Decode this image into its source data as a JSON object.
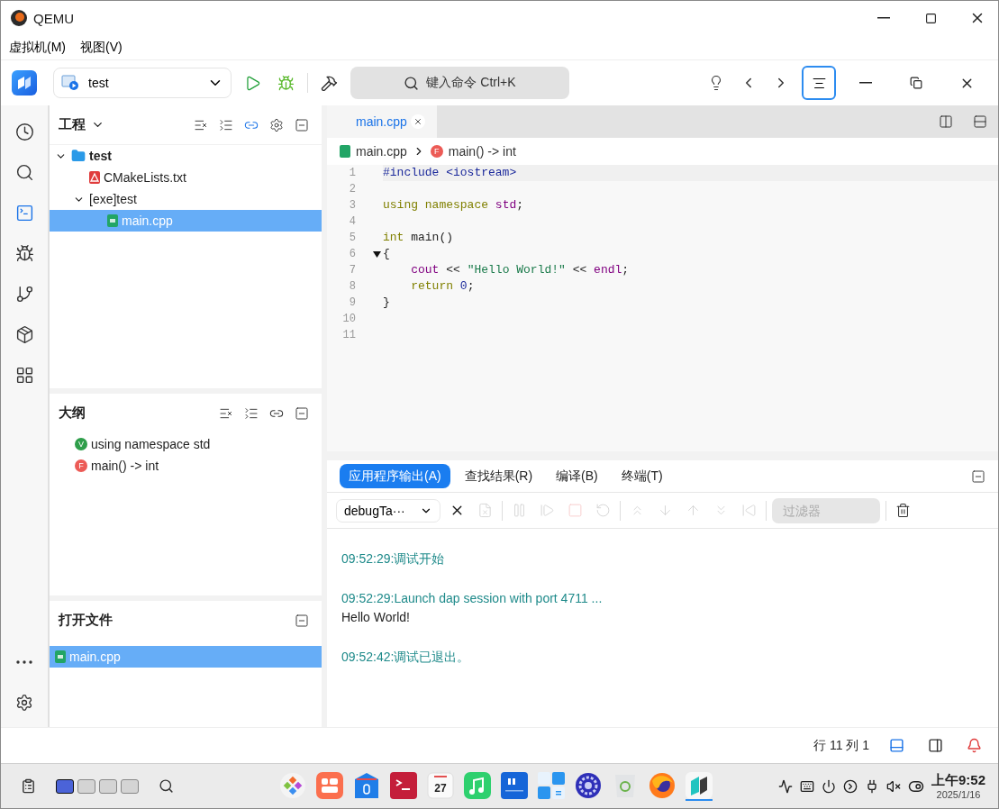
{
  "window": {
    "title": "QEMU"
  },
  "menu": [
    {
      "label": "虚拟机(M)"
    },
    {
      "label": "视图(V)"
    }
  ],
  "toolbar": {
    "target": "test",
    "command": "键入命令 Ctrl+K"
  },
  "activity": [
    {
      "kind": "history",
      "selected": false
    },
    {
      "kind": "search",
      "selected": false
    },
    {
      "kind": "editor",
      "selected": true
    },
    {
      "kind": "debug",
      "selected": false
    },
    {
      "kind": "git",
      "selected": false
    },
    {
      "kind": "package",
      "selected": false
    },
    {
      "kind": "apps",
      "selected": false
    }
  ],
  "project": {
    "title": "工程",
    "tree": [
      {
        "label": "test",
        "kind": "folder",
        "expanded": true,
        "selected": false,
        "children": [
          {
            "label": "CMakeLists.txt",
            "kind": "cmake",
            "selected": false
          },
          {
            "label": "[exe]test",
            "kind": "target",
            "expanded": true,
            "selected": false,
            "children": [
              {
                "label": "main.cpp",
                "kind": "cpp",
                "selected": true
              }
            ]
          }
        ]
      }
    ]
  },
  "outline": {
    "title": "大纲",
    "items": [
      {
        "badge": "V",
        "label": "using namespace std",
        "color": "#2e9e4a"
      },
      {
        "badge": "F",
        "label": "main() -> int",
        "color": "#ec5b56"
      }
    ]
  },
  "open_files": {
    "title": "打开文件",
    "items": [
      {
        "label": "main.cpp",
        "selected": true
      }
    ]
  },
  "editor": {
    "tabs": [
      {
        "label": "main.cpp",
        "selected": true
      }
    ],
    "breadcrumb": [
      {
        "label": "main.cpp",
        "kind": "file"
      },
      {
        "label": "main() -> int",
        "kind": "function",
        "badge": "F"
      }
    ],
    "lines": [
      {
        "number": "1",
        "fold": false,
        "tokens": [
          {
            "text": "#include <iostream>",
            "kind": "directive"
          }
        ]
      },
      {
        "number": "2",
        "fold": false
      },
      {
        "number": "3",
        "fold": false,
        "tokens": [
          {
            "text": "using namespace ",
            "kind": "keyword"
          },
          {
            "text": "std",
            "kind": "name"
          },
          {
            "text": ";",
            "kind": "plain"
          }
        ]
      },
      {
        "number": "4",
        "fold": false
      },
      {
        "number": "5",
        "fold": false,
        "tokens": [
          {
            "text": "int ",
            "kind": "keyword"
          },
          {
            "text": "main()",
            "kind": "plain"
          }
        ]
      },
      {
        "number": "6",
        "fold": true,
        "tokens": [
          {
            "text": "{",
            "kind": "plain"
          }
        ]
      },
      {
        "number": "7",
        "fold": false,
        "tokens": [
          {
            "text": "    cout",
            "kind": "name"
          },
          {
            "text": " << ",
            "kind": "operator"
          },
          {
            "text": "\"Hello World!\"",
            "kind": "string"
          },
          {
            "text": " << ",
            "kind": "operator"
          },
          {
            "text": "endl",
            "kind": "name"
          },
          {
            "text": ";",
            "kind": "plain"
          }
        ]
      },
      {
        "number": "8",
        "fold": false,
        "tokens": [
          {
            "text": "    return ",
            "kind": "keyword"
          },
          {
            "text": "0",
            "kind": "number"
          },
          {
            "text": ";",
            "kind": "plain"
          }
        ]
      },
      {
        "number": "9",
        "fold": false,
        "tokens": [
          {
            "text": "}",
            "kind": "plain"
          }
        ]
      },
      {
        "number": "10",
        "fold": false
      },
      {
        "number": "11",
        "fold": false
      }
    ]
  },
  "output": {
    "tabs": [
      {
        "label": "应用程序输出(A)",
        "selected": true
      },
      {
        "label": "查找结果(R)",
        "selected": false
      },
      {
        "label": "编译(B)",
        "selected": false
      },
      {
        "label": "终端(T)",
        "selected": false
      }
    ],
    "session": "debugTa···",
    "tools": [
      {
        "kind": "close",
        "disabled": false
      },
      {
        "kind": "clear",
        "disabled": true
      },
      {
        "kind": "pause",
        "disabled": true
      },
      {
        "kind": "continue",
        "disabled": true
      },
      {
        "kind": "stop",
        "disabled": true
      },
      {
        "kind": "restart",
        "disabled": true
      },
      {
        "kind": "step-over",
        "disabled": true
      },
      {
        "kind": "step-in",
        "disabled": true
      },
      {
        "kind": "step-out",
        "disabled": true
      },
      {
        "kind": "step-back",
        "disabled": true
      },
      {
        "kind": "reverse",
        "disabled": true
      }
    ],
    "filter": {
      "placeholder": "过滤器"
    },
    "lines": [
      {
        "text": "09:52:29:调试开始",
        "kind": "info"
      },
      {
        "text": "09:52:29:Launch dap session with port 4711 ...",
        "kind": "info"
      },
      {
        "text": "Hello World!",
        "kind": "stdout"
      },
      {
        "text": "09:52:42:调试已退出。",
        "kind": "info"
      }
    ]
  },
  "status_bar": {
    "position": "行 11 列 1"
  },
  "taskbar": {
    "workspaces": [
      {
        "selected": true
      },
      {
        "selected": false
      },
      {
        "selected": false
      },
      {
        "selected": false
      }
    ],
    "dock": [
      {
        "kind": "launcher",
        "running": false
      },
      {
        "kind": "appstore",
        "running": false
      },
      {
        "kind": "files",
        "running": false
      },
      {
        "kind": "terminal",
        "running": false
      },
      {
        "kind": "calendar",
        "label": "27",
        "running": false
      },
      {
        "kind": "music",
        "running": false
      },
      {
        "kind": "notes",
        "running": false
      },
      {
        "kind": "calculator",
        "running": false
      },
      {
        "kind": "control",
        "running": false
      },
      {
        "kind": "trash",
        "running": false
      },
      {
        "kind": "browser",
        "running": false
      },
      {
        "kind": "ide",
        "running": true
      }
    ],
    "time": "上午9:52",
    "date": "2025/1/16"
  }
}
